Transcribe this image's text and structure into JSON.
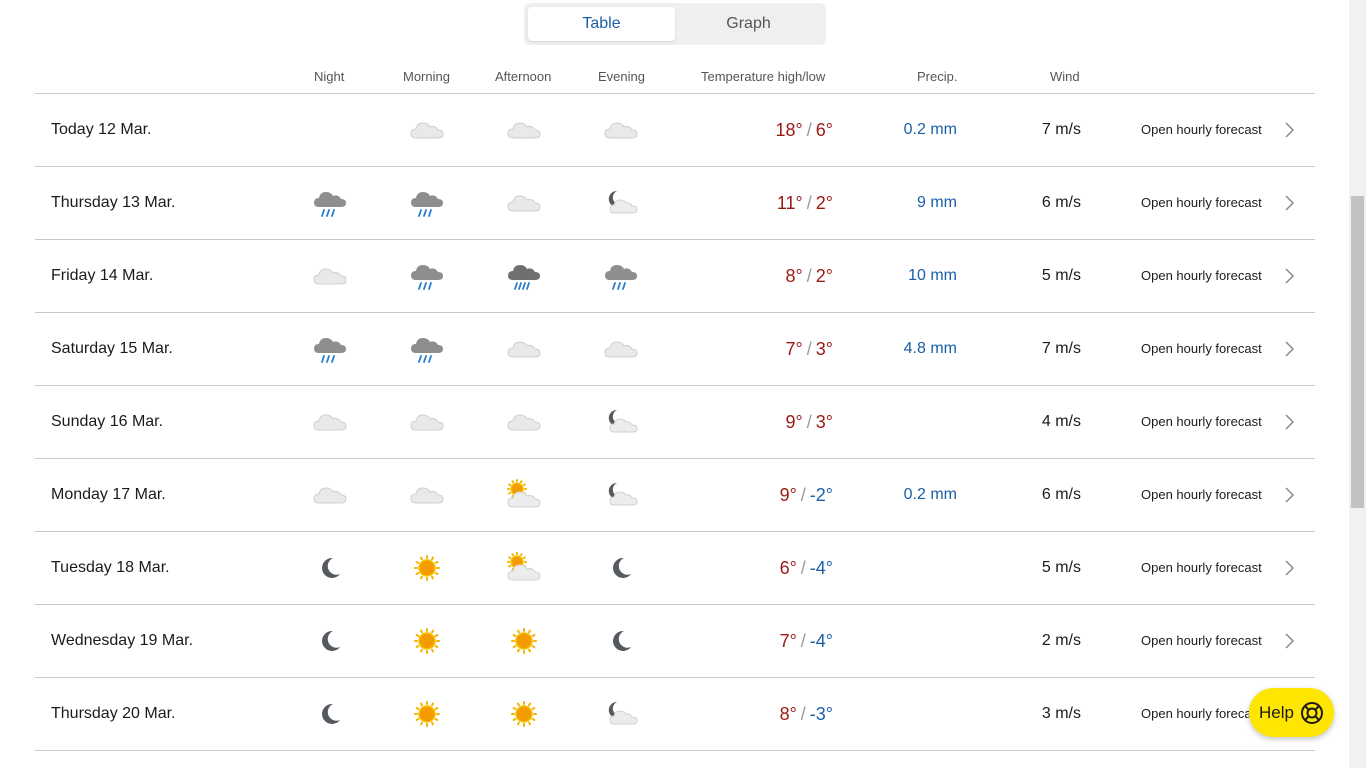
{
  "view_toggle": {
    "table_label": "Table",
    "graph_label": "Graph",
    "selected": "Table"
  },
  "columns": {
    "night": "Night",
    "morning": "Morning",
    "afternoon": "Afternoon",
    "evening": "Evening",
    "temperature": "Temperature high/low",
    "precip": "Precip.",
    "wind": "Wind"
  },
  "rows": [
    {
      "date": "Today 12 Mar.",
      "night": null,
      "morning": "cloudy-icon",
      "afternoon": "cloudy-icon",
      "evening": "cloudy-icon",
      "high": "18°",
      "low": "6°",
      "low_cold": false,
      "precip": "0.2 mm",
      "wind": "7 m/s",
      "link": "Open hourly forecast"
    },
    {
      "date": "Thursday 13 Mar.",
      "night": "rain-icon",
      "morning": "rain-icon",
      "afternoon": "cloudy-icon",
      "evening": "partly-cloudy-night-icon",
      "high": "11°",
      "low": "2°",
      "low_cold": false,
      "precip": "9 mm",
      "wind": "6 m/s",
      "link": "Open hourly forecast"
    },
    {
      "date": "Friday 14 Mar.",
      "night": "cloudy-icon",
      "morning": "rain-icon",
      "afternoon": "heavy-rain-icon",
      "evening": "rain-icon",
      "high": "8°",
      "low": "2°",
      "low_cold": false,
      "precip": "10 mm",
      "wind": "5 m/s",
      "link": "Open hourly forecast"
    },
    {
      "date": "Saturday 15 Mar.",
      "night": "rain-icon",
      "morning": "rain-icon",
      "afternoon": "cloudy-icon",
      "evening": "cloudy-icon",
      "high": "7°",
      "low": "3°",
      "low_cold": false,
      "precip": "4.8 mm",
      "wind": "7 m/s",
      "link": "Open hourly forecast"
    },
    {
      "date": "Sunday 16 Mar.",
      "night": "cloudy-icon",
      "morning": "cloudy-icon",
      "afternoon": "cloudy-icon",
      "evening": "partly-cloudy-night-icon",
      "high": "9°",
      "low": "3°",
      "low_cold": false,
      "precip": "",
      "wind": "4 m/s",
      "link": "Open hourly forecast"
    },
    {
      "date": "Monday 17 Mar.",
      "night": "cloudy-icon",
      "morning": "cloudy-icon",
      "afternoon": "partly-cloudy-day-icon",
      "evening": "partly-cloudy-night-icon",
      "high": "9°",
      "low": "-2°",
      "low_cold": true,
      "precip": "0.2 mm",
      "wind": "6 m/s",
      "link": "Open hourly forecast"
    },
    {
      "date": "Tuesday 18 Mar.",
      "night": "clear-night-icon",
      "morning": "sun-icon",
      "afternoon": "partly-cloudy-day-icon",
      "evening": "clear-night-icon",
      "high": "6°",
      "low": "-4°",
      "low_cold": true,
      "precip": "",
      "wind": "5 m/s",
      "link": "Open hourly forecast"
    },
    {
      "date": "Wednesday 19 Mar.",
      "night": "clear-night-icon",
      "morning": "sun-icon",
      "afternoon": "sun-icon",
      "evening": "clear-night-icon",
      "high": "7°",
      "low": "-4°",
      "low_cold": true,
      "precip": "",
      "wind": "2 m/s",
      "link": "Open hourly forecast"
    },
    {
      "date": "Thursday 20 Mar.",
      "night": "clear-night-icon",
      "morning": "sun-icon",
      "afternoon": "sun-icon",
      "evening": "partly-cloudy-night-icon",
      "high": "8°",
      "low": "-3°",
      "low_cold": true,
      "precip": "",
      "wind": "3 m/s",
      "link": "Open hourly forecast"
    }
  ],
  "help": {
    "label": "Help",
    "icon": "lifebuoy-icon"
  },
  "colors": {
    "warm": "#9a1a14",
    "cold": "#1b5fa8",
    "help_bg": "#ffe600"
  }
}
